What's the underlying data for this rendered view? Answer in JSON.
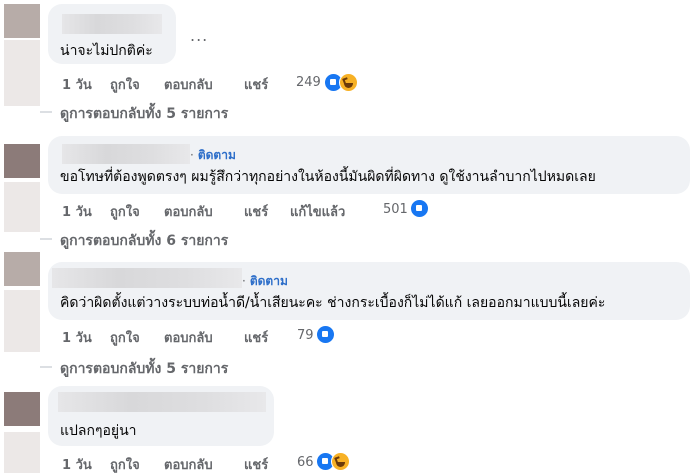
{
  "comments": [
    {
      "show_follow": false,
      "follow_label": "",
      "text": "น่าจะไม่ปกติค่ะ",
      "more_label": "...",
      "actions": {
        "time": "1 วัน",
        "like": "ถูกใจ",
        "reply": "ตอบกลับ",
        "share": "แชร์",
        "edited": ""
      },
      "reaction_count": "249",
      "reactions": [
        "like-icon",
        "haha-icon"
      ],
      "replies_label": "ดูการตอบกลับทั้ง 5 รายการ"
    },
    {
      "show_follow": true,
      "follow_label": "ติดตาม",
      "text": "ขอโทษที่ต้องพูดตรงๆ ผมรู้สึกว่าทุกอย่างในห้องนี้มันผิดที่ผิดทาง ดูใช้งานลำบากไปหมดเลย",
      "actions": {
        "time": "1 วัน",
        "like": "ถูกใจ",
        "reply": "ตอบกลับ",
        "share": "แชร์",
        "edited": "แก้ไขแล้ว"
      },
      "reaction_count": "501",
      "reactions": [
        "like-icon"
      ],
      "replies_label": "ดูการตอบกลับทั้ง 6 รายการ"
    },
    {
      "show_follow": true,
      "follow_label": "ติดตาม",
      "text": "คิดว่าผิดตั้งแต่วางระบบท่อน้ำดี/น้ำเสียนะคะ ช่างกระเบื้องก็ไม่ได้แก้ เลยออกมาแบบนี้เลยค่ะ",
      "actions": {
        "time": "1 วัน",
        "like": "ถูกใจ",
        "reply": "ตอบกลับ",
        "share": "แชร์",
        "edited": ""
      },
      "reaction_count": "79",
      "reactions": [
        "like-icon"
      ],
      "replies_label": "ดูการตอบกลับทั้ง 5 รายการ"
    },
    {
      "show_follow": false,
      "follow_label": "",
      "text": "แปลกๆอยู่นา",
      "actions": {
        "time": "1 วัน",
        "like": "ถูกใจ",
        "reply": "ตอบกลับ",
        "share": "แชร์",
        "edited": ""
      },
      "reaction_count": "66",
      "reactions": [
        "like-icon",
        "haha-icon"
      ],
      "replies_label": ""
    }
  ],
  "colors": {
    "bubble": "#f0f2f5",
    "link": "#2d6ec9",
    "meta": "#65676b",
    "like": "#1877f2",
    "haha": "#f7b125"
  }
}
